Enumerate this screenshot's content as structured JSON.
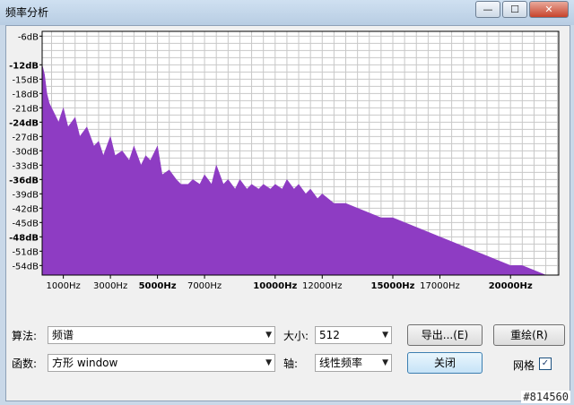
{
  "window": {
    "title": "频率分析",
    "minimize": "—",
    "maximize": "☐",
    "close": "✕"
  },
  "chart_data": {
    "type": "area",
    "color": "#8e3cc3",
    "ytick_labels": [
      "-6dB",
      "-12dB",
      "-15dB",
      "-18dB",
      "-21dB",
      "-24dB",
      "-27dB",
      "-30dB",
      "-33dB",
      "-36dB",
      "-39dB",
      "-42dB",
      "-45dB",
      "-48dB",
      "-51dB",
      "-54dB"
    ],
    "ytick_values": [
      -6,
      -12,
      -15,
      -18,
      -21,
      -24,
      -27,
      -30,
      -33,
      -36,
      -39,
      -42,
      -45,
      -48,
      -51,
      -54
    ],
    "xtick_labels": [
      "1000Hz",
      "3000Hz",
      "5000Hz",
      "7000Hz",
      "10000Hz",
      "12000Hz",
      "15000Hz",
      "17000Hz",
      "20000Hz"
    ],
    "xtick_values": [
      1000,
      3000,
      5000,
      7000,
      10000,
      12000,
      15000,
      17000,
      20000
    ],
    "xlim": [
      100,
      22050
    ],
    "ylim": [
      -56,
      -5
    ],
    "grid": true,
    "x": [
      100,
      200,
      300,
      400,
      600,
      800,
      1000,
      1200,
      1500,
      1700,
      2000,
      2300,
      2500,
      2700,
      3000,
      3200,
      3500,
      3800,
      4000,
      4300,
      4500,
      4700,
      5000,
      5200,
      5500,
      5800,
      6000,
      6300,
      6500,
      6800,
      7000,
      7300,
      7500,
      7800,
      8000,
      8300,
      8500,
      8800,
      9000,
      9300,
      9500,
      9800,
      10000,
      10300,
      10500,
      10800,
      11000,
      11300,
      11500,
      11800,
      12000,
      12500,
      13000,
      13500,
      14000,
      14500,
      15000,
      15500,
      16000,
      16500,
      17000,
      17500,
      18000,
      18500,
      19000,
      19500,
      20000,
      20500,
      21000,
      21500,
      22050
    ],
    "y": [
      -12,
      -14,
      -18,
      -20,
      -22,
      -24,
      -21,
      -25,
      -23,
      -27,
      -25,
      -29,
      -28,
      -31,
      -27,
      -31,
      -30,
      -32,
      -29,
      -33,
      -31,
      -32,
      -29,
      -35,
      -34,
      -36,
      -37,
      -37,
      -36,
      -37,
      -35,
      -37,
      -33,
      -37,
      -36,
      -38,
      -36,
      -38,
      -37,
      -38,
      -37,
      -38,
      -37,
      -38,
      -36,
      -38,
      -37,
      -39,
      -38,
      -40,
      -39,
      -41,
      -41,
      -42,
      -43,
      -44,
      -44,
      -45,
      -46,
      -47,
      -48,
      -49,
      -50,
      -51,
      -52,
      -53,
      -54,
      -54,
      -55,
      -56,
      -56
    ]
  },
  "controls": {
    "algorithm_label": "算法:",
    "algorithm_value": "频谱",
    "size_label": "大小:",
    "size_value": "512",
    "export_button": "导出...(E)",
    "replot_button": "重绘(R)",
    "function_label": "函数:",
    "function_value": "方形 window",
    "axis_label": "轴:",
    "axis_value": "线性频率",
    "close_button": "关闭",
    "grid_label": "网格",
    "grid_checked": "✓"
  },
  "watermark": "#814560"
}
